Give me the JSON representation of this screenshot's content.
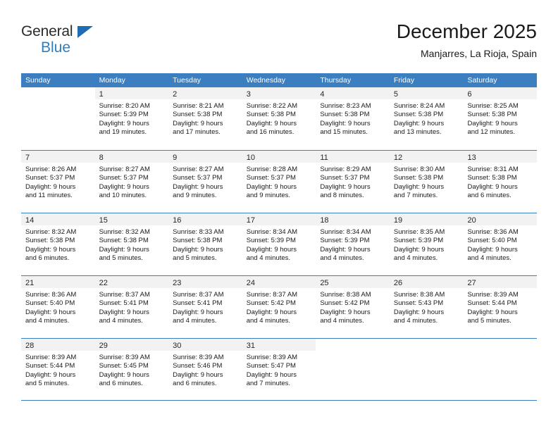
{
  "brand": {
    "name_top": "General",
    "name_bottom": "Blue",
    "triangle_color": "#1f6cb4",
    "blue_text_color": "#2e7ec1"
  },
  "header": {
    "title": "December 2025",
    "location": "Manjarres, La Rioja, Spain"
  },
  "theme": {
    "header_blue": "#3c7fc1",
    "day_band_gray": "#f2f2f2",
    "text": "#1a1a1a"
  },
  "weekdays": [
    "Sunday",
    "Monday",
    "Tuesday",
    "Wednesday",
    "Thursday",
    "Friday",
    "Saturday"
  ],
  "weeks": [
    [
      {
        "day": "",
        "sunrise": "",
        "sunset": "",
        "daylight_1": "",
        "daylight_2": ""
      },
      {
        "day": "1",
        "sunrise": "Sunrise: 8:20 AM",
        "sunset": "Sunset: 5:39 PM",
        "daylight_1": "Daylight: 9 hours",
        "daylight_2": "and 19 minutes."
      },
      {
        "day": "2",
        "sunrise": "Sunrise: 8:21 AM",
        "sunset": "Sunset: 5:38 PM",
        "daylight_1": "Daylight: 9 hours",
        "daylight_2": "and 17 minutes."
      },
      {
        "day": "3",
        "sunrise": "Sunrise: 8:22 AM",
        "sunset": "Sunset: 5:38 PM",
        "daylight_1": "Daylight: 9 hours",
        "daylight_2": "and 16 minutes."
      },
      {
        "day": "4",
        "sunrise": "Sunrise: 8:23 AM",
        "sunset": "Sunset: 5:38 PM",
        "daylight_1": "Daylight: 9 hours",
        "daylight_2": "and 15 minutes."
      },
      {
        "day": "5",
        "sunrise": "Sunrise: 8:24 AM",
        "sunset": "Sunset: 5:38 PM",
        "daylight_1": "Daylight: 9 hours",
        "daylight_2": "and 13 minutes."
      },
      {
        "day": "6",
        "sunrise": "Sunrise: 8:25 AM",
        "sunset": "Sunset: 5:38 PM",
        "daylight_1": "Daylight: 9 hours",
        "daylight_2": "and 12 minutes."
      }
    ],
    [
      {
        "day": "7",
        "sunrise": "Sunrise: 8:26 AM",
        "sunset": "Sunset: 5:37 PM",
        "daylight_1": "Daylight: 9 hours",
        "daylight_2": "and 11 minutes."
      },
      {
        "day": "8",
        "sunrise": "Sunrise: 8:27 AM",
        "sunset": "Sunset: 5:37 PM",
        "daylight_1": "Daylight: 9 hours",
        "daylight_2": "and 10 minutes."
      },
      {
        "day": "9",
        "sunrise": "Sunrise: 8:27 AM",
        "sunset": "Sunset: 5:37 PM",
        "daylight_1": "Daylight: 9 hours",
        "daylight_2": "and 9 minutes."
      },
      {
        "day": "10",
        "sunrise": "Sunrise: 8:28 AM",
        "sunset": "Sunset: 5:37 PM",
        "daylight_1": "Daylight: 9 hours",
        "daylight_2": "and 9 minutes."
      },
      {
        "day": "11",
        "sunrise": "Sunrise: 8:29 AM",
        "sunset": "Sunset: 5:37 PM",
        "daylight_1": "Daylight: 9 hours",
        "daylight_2": "and 8 minutes."
      },
      {
        "day": "12",
        "sunrise": "Sunrise: 8:30 AM",
        "sunset": "Sunset: 5:38 PM",
        "daylight_1": "Daylight: 9 hours",
        "daylight_2": "and 7 minutes."
      },
      {
        "day": "13",
        "sunrise": "Sunrise: 8:31 AM",
        "sunset": "Sunset: 5:38 PM",
        "daylight_1": "Daylight: 9 hours",
        "daylight_2": "and 6 minutes."
      }
    ],
    [
      {
        "day": "14",
        "sunrise": "Sunrise: 8:32 AM",
        "sunset": "Sunset: 5:38 PM",
        "daylight_1": "Daylight: 9 hours",
        "daylight_2": "and 6 minutes."
      },
      {
        "day": "15",
        "sunrise": "Sunrise: 8:32 AM",
        "sunset": "Sunset: 5:38 PM",
        "daylight_1": "Daylight: 9 hours",
        "daylight_2": "and 5 minutes."
      },
      {
        "day": "16",
        "sunrise": "Sunrise: 8:33 AM",
        "sunset": "Sunset: 5:38 PM",
        "daylight_1": "Daylight: 9 hours",
        "daylight_2": "and 5 minutes."
      },
      {
        "day": "17",
        "sunrise": "Sunrise: 8:34 AM",
        "sunset": "Sunset: 5:39 PM",
        "daylight_1": "Daylight: 9 hours",
        "daylight_2": "and 4 minutes."
      },
      {
        "day": "18",
        "sunrise": "Sunrise: 8:34 AM",
        "sunset": "Sunset: 5:39 PM",
        "daylight_1": "Daylight: 9 hours",
        "daylight_2": "and 4 minutes."
      },
      {
        "day": "19",
        "sunrise": "Sunrise: 8:35 AM",
        "sunset": "Sunset: 5:39 PM",
        "daylight_1": "Daylight: 9 hours",
        "daylight_2": "and 4 minutes."
      },
      {
        "day": "20",
        "sunrise": "Sunrise: 8:36 AM",
        "sunset": "Sunset: 5:40 PM",
        "daylight_1": "Daylight: 9 hours",
        "daylight_2": "and 4 minutes."
      }
    ],
    [
      {
        "day": "21",
        "sunrise": "Sunrise: 8:36 AM",
        "sunset": "Sunset: 5:40 PM",
        "daylight_1": "Daylight: 9 hours",
        "daylight_2": "and 4 minutes."
      },
      {
        "day": "22",
        "sunrise": "Sunrise: 8:37 AM",
        "sunset": "Sunset: 5:41 PM",
        "daylight_1": "Daylight: 9 hours",
        "daylight_2": "and 4 minutes."
      },
      {
        "day": "23",
        "sunrise": "Sunrise: 8:37 AM",
        "sunset": "Sunset: 5:41 PM",
        "daylight_1": "Daylight: 9 hours",
        "daylight_2": "and 4 minutes."
      },
      {
        "day": "24",
        "sunrise": "Sunrise: 8:37 AM",
        "sunset": "Sunset: 5:42 PM",
        "daylight_1": "Daylight: 9 hours",
        "daylight_2": "and 4 minutes."
      },
      {
        "day": "25",
        "sunrise": "Sunrise: 8:38 AM",
        "sunset": "Sunset: 5:42 PM",
        "daylight_1": "Daylight: 9 hours",
        "daylight_2": "and 4 minutes."
      },
      {
        "day": "26",
        "sunrise": "Sunrise: 8:38 AM",
        "sunset": "Sunset: 5:43 PM",
        "daylight_1": "Daylight: 9 hours",
        "daylight_2": "and 4 minutes."
      },
      {
        "day": "27",
        "sunrise": "Sunrise: 8:39 AM",
        "sunset": "Sunset: 5:44 PM",
        "daylight_1": "Daylight: 9 hours",
        "daylight_2": "and 5 minutes."
      }
    ],
    [
      {
        "day": "28",
        "sunrise": "Sunrise: 8:39 AM",
        "sunset": "Sunset: 5:44 PM",
        "daylight_1": "Daylight: 9 hours",
        "daylight_2": "and 5 minutes."
      },
      {
        "day": "29",
        "sunrise": "Sunrise: 8:39 AM",
        "sunset": "Sunset: 5:45 PM",
        "daylight_1": "Daylight: 9 hours",
        "daylight_2": "and 6 minutes."
      },
      {
        "day": "30",
        "sunrise": "Sunrise: 8:39 AM",
        "sunset": "Sunset: 5:46 PM",
        "daylight_1": "Daylight: 9 hours",
        "daylight_2": "and 6 minutes."
      },
      {
        "day": "31",
        "sunrise": "Sunrise: 8:39 AM",
        "sunset": "Sunset: 5:47 PM",
        "daylight_1": "Daylight: 9 hours",
        "daylight_2": "and 7 minutes."
      },
      {
        "day": "",
        "sunrise": "",
        "sunset": "",
        "daylight_1": "",
        "daylight_2": ""
      },
      {
        "day": "",
        "sunrise": "",
        "sunset": "",
        "daylight_1": "",
        "daylight_2": ""
      },
      {
        "day": "",
        "sunrise": "",
        "sunset": "",
        "daylight_1": "",
        "daylight_2": ""
      }
    ]
  ]
}
